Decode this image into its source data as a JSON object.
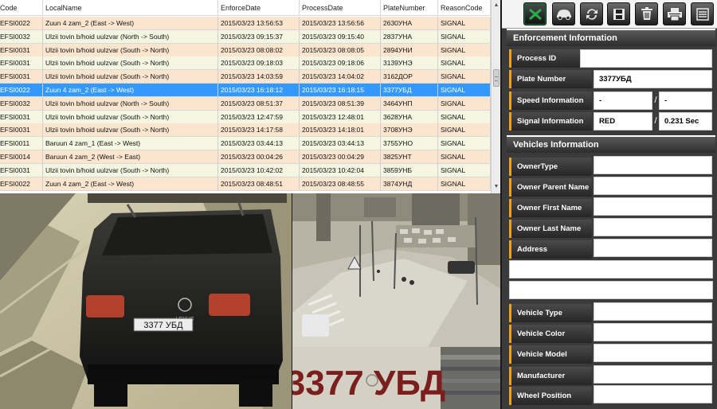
{
  "grid": {
    "columns": [
      "Code",
      "LocalName",
      "EnforceDate",
      "ProcessDate",
      "PlateNumber",
      "ReasonCode"
    ],
    "rows": [
      {
        "code": "EFSI0022",
        "local": "Zuun 4 zam_2 (East -> West)",
        "enforce": "2015/03/23 13:56:53",
        "process": "2015/03/23 13:56:56",
        "plate": "2630УНА",
        "reason": "SIGNAL"
      },
      {
        "code": "EFSI0032",
        "local": "Ulzii tovin b/hoid uulzvar (North -> South)",
        "enforce": "2015/03/23 09:15:37",
        "process": "2015/03/23 09:15:40",
        "plate": "2837УНА",
        "reason": "SIGNAL"
      },
      {
        "code": "EFSI0031",
        "local": "Ulzii tovin b/hoid uulzvar (South -> North)",
        "enforce": "2015/03/23 08:08:02",
        "process": "2015/03/23 08:08:05",
        "plate": "2894УНИ",
        "reason": "SIGNAL"
      },
      {
        "code": "EFSI0031",
        "local": "Ulzii tovin b/hoid uulzvar (South -> North)",
        "enforce": "2015/03/23 09:18:03",
        "process": "2015/03/23 09:18:06",
        "plate": "3139УНЭ",
        "reason": "SIGNAL"
      },
      {
        "code": "EFSI0031",
        "local": "Ulzii tovin b/hoid uulzvar (South -> North)",
        "enforce": "2015/03/23 14:03:59",
        "process": "2015/03/23 14:04:02",
        "plate": "3162ДОР",
        "reason": "SIGNAL"
      },
      {
        "code": "EFSI0022",
        "local": "Zuun 4 zam_2 (East -> West)",
        "enforce": "2015/03/23 16:18:12",
        "process": "2015/03/23 16:18:15",
        "plate": "3377УБД",
        "reason": "SIGNAL"
      },
      {
        "code": "EFSI0032",
        "local": "Ulzii tovin b/hoid uulzvar (North -> South)",
        "enforce": "2015/03/23 08:51:37",
        "process": "2015/03/23 08:51:39",
        "plate": "3464УНП",
        "reason": "SIGNAL"
      },
      {
        "code": "EFSI0031",
        "local": "Ulzii tovin b/hoid uulzvar (South -> North)",
        "enforce": "2015/03/23 12:47:59",
        "process": "2015/03/23 12:48:01",
        "plate": "3628УНА",
        "reason": "SIGNAL"
      },
      {
        "code": "EFSI0031",
        "local": "Ulzii tovin b/hoid uulzvar (South -> North)",
        "enforce": "2015/03/23 14:17:58",
        "process": "2015/03/23 14:18:01",
        "plate": "3708УНЭ",
        "reason": "SIGNAL"
      },
      {
        "code": "EFSI0011",
        "local": "Baruun 4 zam_1 (East -> West)",
        "enforce": "2015/03/23 03:44:13",
        "process": "2015/03/23 03:44:13",
        "plate": "3755УНО",
        "reason": "SIGNAL"
      },
      {
        "code": "EFSI0014",
        "local": "Baruun 4 zam_2 (West -> East)",
        "enforce": "2015/03/23 00:04:26",
        "process": "2015/03/23 00:04:29",
        "plate": "3825УНТ",
        "reason": "SIGNAL"
      },
      {
        "code": "EFSI0031",
        "local": "Ulzii tovin b/hoid uulzvar (South -> North)",
        "enforce": "2015/03/23 10:42:02",
        "process": "2015/03/23 10:42:04",
        "plate": "3859УНБ",
        "reason": "SIGNAL"
      },
      {
        "code": "EFSI0022",
        "local": "Zuun 4 zam_2 (East -> West)",
        "enforce": "2015/03/23 08:48:51",
        "process": "2015/03/23 08:48:55",
        "plate": "3874УНД",
        "reason": "SIGNAL"
      }
    ],
    "selected_index": 5,
    "scroll_position": 0.38
  },
  "images": {
    "plate_text": "3377 УБД",
    "vehicle_brand": "LEXUS"
  },
  "toolbar": {
    "buttons": [
      "excel-icon",
      "car-icon",
      "refresh-icon",
      "save-icon",
      "trash-icon",
      "printer-icon",
      "list-icon"
    ]
  },
  "enforcement": {
    "title": "Enforcement Information",
    "process_id_label": "Process ID",
    "process_id_value": "",
    "plate_label": "Plate Number",
    "plate_value": "3377УБД",
    "speed_label": "Speed Information",
    "speed_value_1": "-",
    "speed_value_2": "-",
    "signal_label": "Signal Information",
    "signal_value_1": "RED",
    "signal_value_2": "0.231 Sec",
    "separator": "/"
  },
  "vehicles": {
    "title": "Vehicles Information",
    "owner_type_label": "OwnerType",
    "owner_parent_label": "Owner Parent Name",
    "owner_first_label": "Owner First Name",
    "owner_last_label": "Owner Last Name",
    "address_label": "Address",
    "vehicle_type_label": "Vehicle Type",
    "vehicle_color_label": "Vehicle Color",
    "vehicle_model_label": "Vehicle Model",
    "manufacturer_label": "Manufacturer",
    "wheel_position_label": "Wheel Position"
  },
  "colors": {
    "row_even": "#fbe5cf",
    "row_odd": "#f4f6e2",
    "row_selected": "#3399ff",
    "label_accent": "#f0a020",
    "panel_bg": "#3b3b3b"
  }
}
